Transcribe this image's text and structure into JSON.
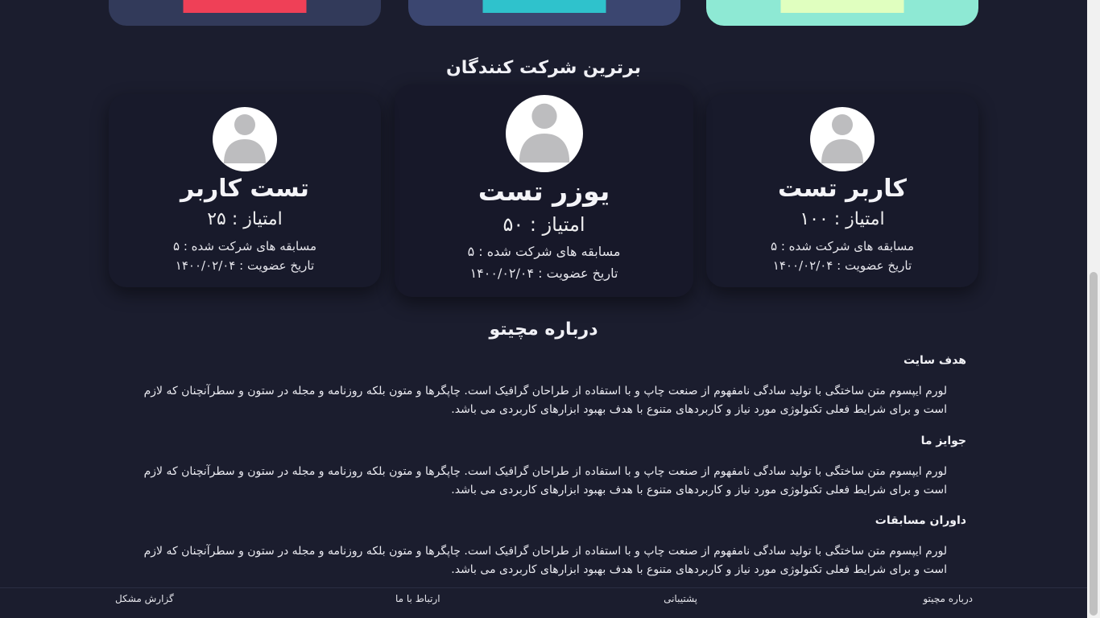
{
  "top_cards": [
    {
      "color": "#323a5a",
      "accent": "#ef4057"
    },
    {
      "color": "#3b4670",
      "accent": "#2fc2cc"
    },
    {
      "color": "#8ee9d4",
      "accent": "#e0ffbf"
    }
  ],
  "top_participants": {
    "title": "برترین شرکت کنندگان",
    "users": [
      {
        "name": "کاربر تست",
        "score": "امتیاز : ۱۰۰",
        "contests": "مسابقه های شرکت شده : ۵",
        "joined": "تاریخ عضویت : ۱۴۰۰/۰۲/۰۴"
      },
      {
        "name": "یوزر تست",
        "score": "امتیاز : ۵۰",
        "contests": "مسابقه های شرکت شده : ۵",
        "joined": "تاریخ عضویت : ۱۴۰۰/۰۲/۰۴"
      },
      {
        "name": "تست کاربر",
        "score": "امتیاز : ۲۵",
        "contests": "مسابقه های شرکت شده : ۵",
        "joined": "تاریخ عضویت : ۱۴۰۰/۰۲/۰۴"
      }
    ]
  },
  "about": {
    "title": "درباره مچیتو",
    "sections": [
      {
        "heading": "هدف سایت",
        "text": "لورم ایپسوم متن ساختگی با تولید سادگی نامفهوم از صنعت چاپ و با استفاده از طراحان گرافیک است. چاپگرها و متون بلکه روزنامه و مجله در ستون و سطرآنچنان که لازم است و برای شرایط فعلی تکنولوژی مورد نیاز و کاربردهای متنوع با هدف بهبود ابزارهای کاربردی می باشد."
      },
      {
        "heading": "جوایز ما",
        "text": "لورم ایپسوم متن ساختگی با تولید سادگی نامفهوم از صنعت چاپ و با استفاده از طراحان گرافیک است. چاپگرها و متون بلکه روزنامه و مجله در ستون و سطرآنچنان که لازم است و برای شرایط فعلی تکنولوژی مورد نیاز و کاربردهای متنوع با هدف بهبود ابزارهای کاربردی می باشد."
      },
      {
        "heading": "داوران مسابقات",
        "text": "لورم ایپسوم متن ساختگی با تولید سادگی نامفهوم از صنعت چاپ و با استفاده از طراحان گرافیک است. چاپگرها و متون بلکه روزنامه و مجله در ستون و سطرآنچنان که لازم است و برای شرایط فعلی تکنولوژی مورد نیاز و کاربردهای متنوع با هدف بهبود ابزارهای کاربردی می باشد."
      }
    ]
  },
  "footer": {
    "about": "درباره مچیتو",
    "support": "پشتیبانی",
    "contact": "ارتباط با ما",
    "report": "گزارش مشکل"
  }
}
